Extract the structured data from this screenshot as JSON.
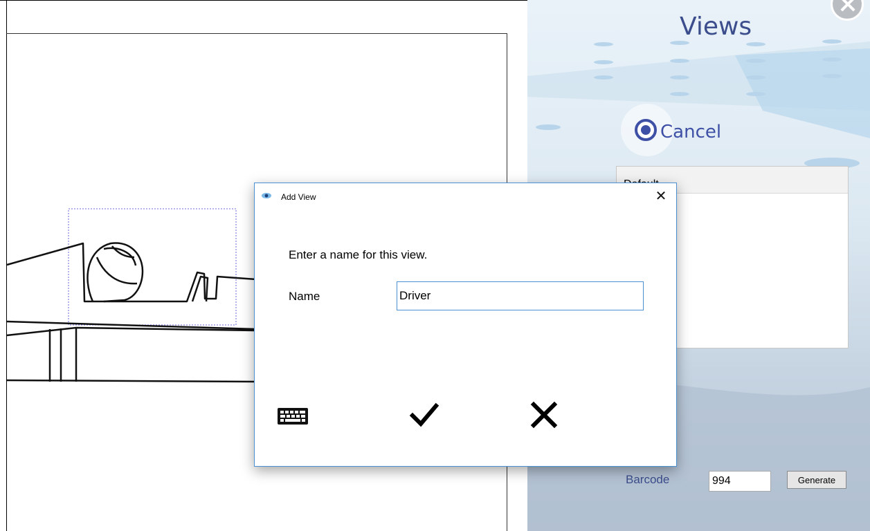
{
  "views_panel": {
    "title": "Views",
    "cancel_label": "Cancel",
    "views": [
      {
        "label": "Default"
      }
    ],
    "barcode_label": "Barcode",
    "barcode_value": "994",
    "generate_label": "Generate",
    "title_color": "#3b4d8c",
    "accent_color": "#3e4fa6"
  },
  "dialog": {
    "title": "Add View",
    "close_glyph": "✕",
    "prompt": "Enter a name for this view.",
    "name_label": "Name",
    "name_value": "Driver",
    "buttons": {
      "keyboard_icon": "keyboard-icon",
      "ok_icon": "checkmark-icon",
      "cancel_icon": "x-icon"
    },
    "border_color": "#4a90d0"
  }
}
